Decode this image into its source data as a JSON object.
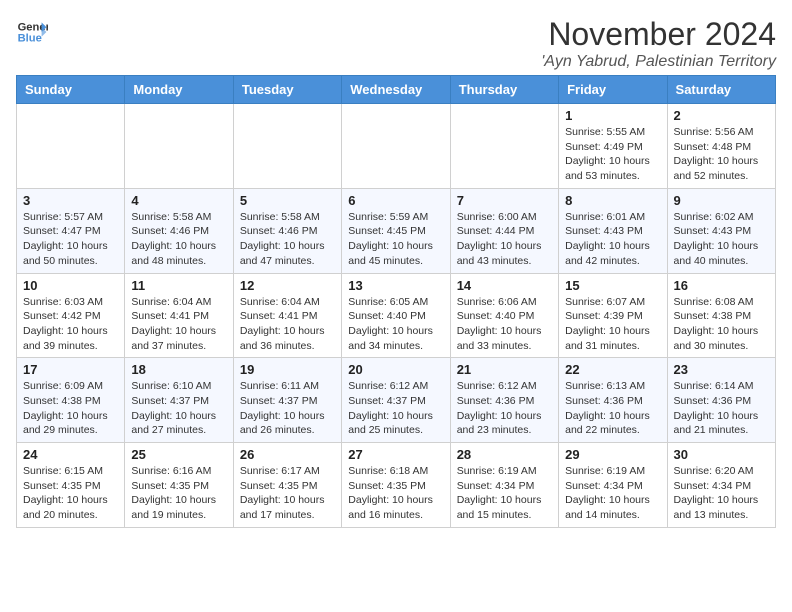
{
  "logo": {
    "line1": "General",
    "line2": "Blue"
  },
  "title": "November 2024",
  "subtitle": "'Ayn Yabrud, Palestinian Territory",
  "weekdays": [
    "Sunday",
    "Monday",
    "Tuesday",
    "Wednesday",
    "Thursday",
    "Friday",
    "Saturday"
  ],
  "weeks": [
    [
      {
        "day": "",
        "info": ""
      },
      {
        "day": "",
        "info": ""
      },
      {
        "day": "",
        "info": ""
      },
      {
        "day": "",
        "info": ""
      },
      {
        "day": "",
        "info": ""
      },
      {
        "day": "1",
        "info": "Sunrise: 5:55 AM\nSunset: 4:49 PM\nDaylight: 10 hours\nand 53 minutes."
      },
      {
        "day": "2",
        "info": "Sunrise: 5:56 AM\nSunset: 4:48 PM\nDaylight: 10 hours\nand 52 minutes."
      }
    ],
    [
      {
        "day": "3",
        "info": "Sunrise: 5:57 AM\nSunset: 4:47 PM\nDaylight: 10 hours\nand 50 minutes."
      },
      {
        "day": "4",
        "info": "Sunrise: 5:58 AM\nSunset: 4:46 PM\nDaylight: 10 hours\nand 48 minutes."
      },
      {
        "day": "5",
        "info": "Sunrise: 5:58 AM\nSunset: 4:46 PM\nDaylight: 10 hours\nand 47 minutes."
      },
      {
        "day": "6",
        "info": "Sunrise: 5:59 AM\nSunset: 4:45 PM\nDaylight: 10 hours\nand 45 minutes."
      },
      {
        "day": "7",
        "info": "Sunrise: 6:00 AM\nSunset: 4:44 PM\nDaylight: 10 hours\nand 43 minutes."
      },
      {
        "day": "8",
        "info": "Sunrise: 6:01 AM\nSunset: 4:43 PM\nDaylight: 10 hours\nand 42 minutes."
      },
      {
        "day": "9",
        "info": "Sunrise: 6:02 AM\nSunset: 4:43 PM\nDaylight: 10 hours\nand 40 minutes."
      }
    ],
    [
      {
        "day": "10",
        "info": "Sunrise: 6:03 AM\nSunset: 4:42 PM\nDaylight: 10 hours\nand 39 minutes."
      },
      {
        "day": "11",
        "info": "Sunrise: 6:04 AM\nSunset: 4:41 PM\nDaylight: 10 hours\nand 37 minutes."
      },
      {
        "day": "12",
        "info": "Sunrise: 6:04 AM\nSunset: 4:41 PM\nDaylight: 10 hours\nand 36 minutes."
      },
      {
        "day": "13",
        "info": "Sunrise: 6:05 AM\nSunset: 4:40 PM\nDaylight: 10 hours\nand 34 minutes."
      },
      {
        "day": "14",
        "info": "Sunrise: 6:06 AM\nSunset: 4:40 PM\nDaylight: 10 hours\nand 33 minutes."
      },
      {
        "day": "15",
        "info": "Sunrise: 6:07 AM\nSunset: 4:39 PM\nDaylight: 10 hours\nand 31 minutes."
      },
      {
        "day": "16",
        "info": "Sunrise: 6:08 AM\nSunset: 4:38 PM\nDaylight: 10 hours\nand 30 minutes."
      }
    ],
    [
      {
        "day": "17",
        "info": "Sunrise: 6:09 AM\nSunset: 4:38 PM\nDaylight: 10 hours\nand 29 minutes."
      },
      {
        "day": "18",
        "info": "Sunrise: 6:10 AM\nSunset: 4:37 PM\nDaylight: 10 hours\nand 27 minutes."
      },
      {
        "day": "19",
        "info": "Sunrise: 6:11 AM\nSunset: 4:37 PM\nDaylight: 10 hours\nand 26 minutes."
      },
      {
        "day": "20",
        "info": "Sunrise: 6:12 AM\nSunset: 4:37 PM\nDaylight: 10 hours\nand 25 minutes."
      },
      {
        "day": "21",
        "info": "Sunrise: 6:12 AM\nSunset: 4:36 PM\nDaylight: 10 hours\nand 23 minutes."
      },
      {
        "day": "22",
        "info": "Sunrise: 6:13 AM\nSunset: 4:36 PM\nDaylight: 10 hours\nand 22 minutes."
      },
      {
        "day": "23",
        "info": "Sunrise: 6:14 AM\nSunset: 4:36 PM\nDaylight: 10 hours\nand 21 minutes."
      }
    ],
    [
      {
        "day": "24",
        "info": "Sunrise: 6:15 AM\nSunset: 4:35 PM\nDaylight: 10 hours\nand 20 minutes."
      },
      {
        "day": "25",
        "info": "Sunrise: 6:16 AM\nSunset: 4:35 PM\nDaylight: 10 hours\nand 19 minutes."
      },
      {
        "day": "26",
        "info": "Sunrise: 6:17 AM\nSunset: 4:35 PM\nDaylight: 10 hours\nand 17 minutes."
      },
      {
        "day": "27",
        "info": "Sunrise: 6:18 AM\nSunset: 4:35 PM\nDaylight: 10 hours\nand 16 minutes."
      },
      {
        "day": "28",
        "info": "Sunrise: 6:19 AM\nSunset: 4:34 PM\nDaylight: 10 hours\nand 15 minutes."
      },
      {
        "day": "29",
        "info": "Sunrise: 6:19 AM\nSunset: 4:34 PM\nDaylight: 10 hours\nand 14 minutes."
      },
      {
        "day": "30",
        "info": "Sunrise: 6:20 AM\nSunset: 4:34 PM\nDaylight: 10 hours\nand 13 minutes."
      }
    ]
  ]
}
